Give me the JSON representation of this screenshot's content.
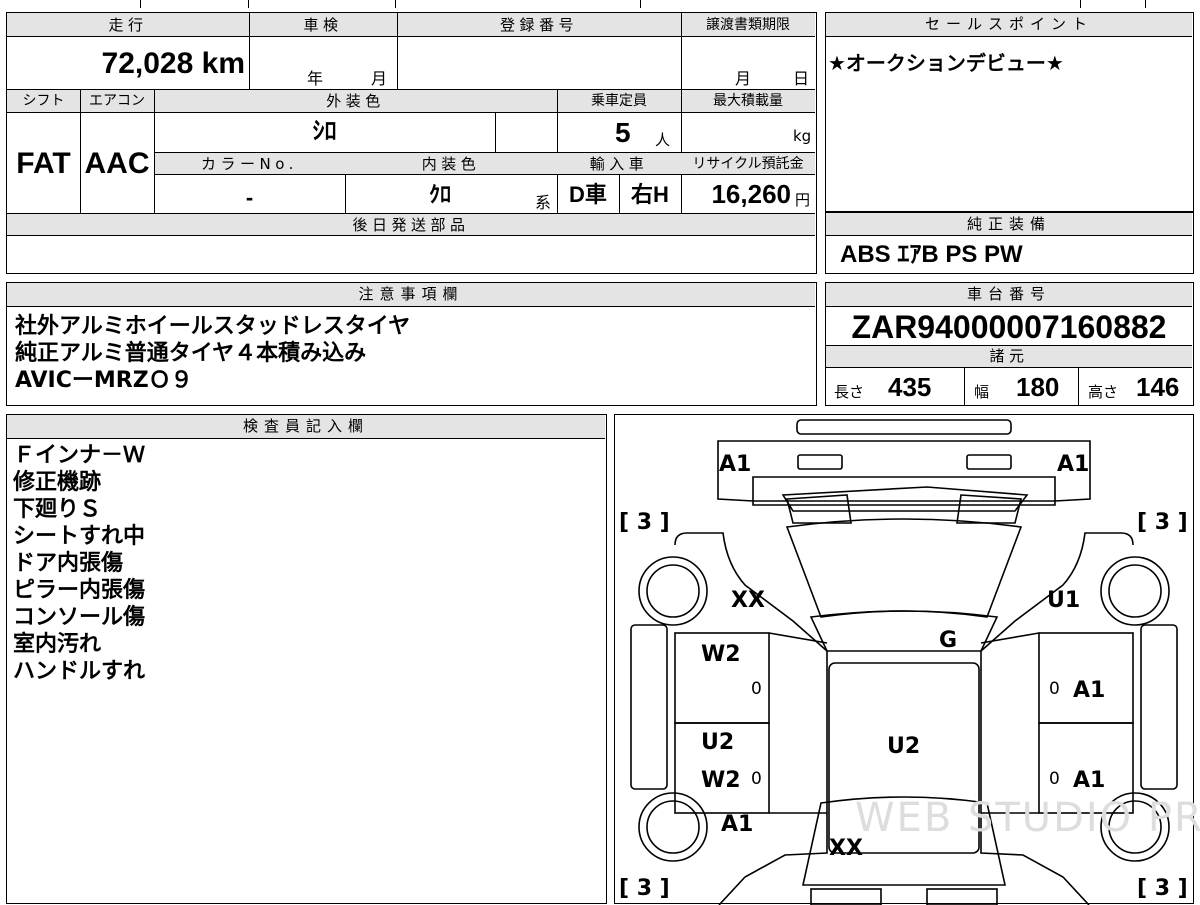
{
  "vehicle": {
    "mileage_label": "走行",
    "mileage_value": "72,028 km",
    "inspection_label": "車検",
    "inspection_year": "年",
    "inspection_month": "月",
    "registration_label": "登録番号",
    "registration_value": "",
    "transfer_label": "譲渡書類期限",
    "transfer_month": "月",
    "transfer_day": "日",
    "shift_label": "シフト",
    "shift_value": "FAT",
    "aircon_label": "エアコン",
    "aircon_value": "AAC",
    "exterior_label": "外装色",
    "exterior_value": "ｼﾛ",
    "capacity_label": "乗車定員",
    "capacity_value": "5",
    "capacity_unit": "人",
    "maxload_label": "最大積載量",
    "maxload_unit": "kg",
    "colorno_label": "カラーNo.",
    "colorno_value": "-",
    "interior_label": "内装色",
    "interior_value": "ｸﾛ",
    "interior_suffix": "系",
    "import_label": "輸入車",
    "import_d": "D車",
    "import_h": "右H",
    "recycle_label": "リサイクル預託金",
    "recycle_value": "16,260",
    "recycle_unit": "円",
    "later_parts_label": "後日発送部品"
  },
  "sales_point": {
    "label": "セールスポイント",
    "text": "★オークションデビュー★"
  },
  "equipment": {
    "label": "純正装備",
    "text": "ABS ｴｱB PS PW"
  },
  "notes": {
    "label": "注意事項欄",
    "lines": [
      "社外アルミホイールスタッドレスタイヤ",
      "純正アルミ普通タイヤ４本積み込み",
      "AVICーMRZＯ９"
    ]
  },
  "chassis": {
    "label": "車台番号",
    "value": "ZAR94000007160882",
    "specs_label": "諸元",
    "length_label": "長さ",
    "length_value": "435",
    "width_label": "幅",
    "width_value": "180",
    "height_label": "高さ",
    "height_value": "146"
  },
  "inspector": {
    "label": "検査員記入欄",
    "lines": [
      "Ｆインナ－Ｗ",
      "修正機跡",
      "下廻りＳ",
      "シートすれ中",
      "ドア内張傷",
      "ピラー内張傷",
      "コンソール傷",
      "室内汚れ",
      "ハンドルすれ"
    ]
  },
  "diagram": {
    "a1_front_left": "A1",
    "a1_front_right": "A1",
    "tire_fl": "[ 3 ]",
    "tire_fr": "[ 3 ]",
    "tire_rl": "[ 3 ]",
    "tire_rr": "[ 3 ]",
    "xx_front": "XX",
    "u1": "U1",
    "g": "G",
    "w2_front_left": "W2",
    "zero_1": "0",
    "zero_2": "0",
    "a1_right_front_door": "A1",
    "u2_left": "U2",
    "u2_roof": "U2",
    "w2_rear_left": "W2",
    "zero_3": "0",
    "zero_4": "0",
    "a1_right_rear_door": "A1",
    "a1_rear_left": "A1",
    "xx_rear": "XX",
    "watermark": "WEB STUDIO PRO"
  }
}
